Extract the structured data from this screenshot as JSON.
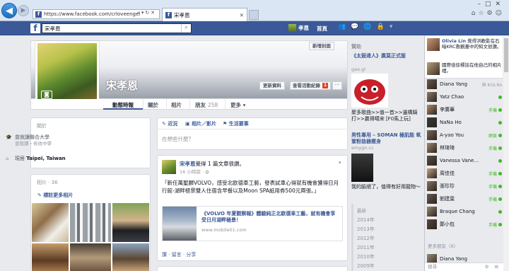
{
  "browser": {
    "address": "https://www.facebook.com/crloveengel",
    "tab_title": "宋孝恩",
    "back_icon": "back-arrow-icon",
    "forward_icon": "forward-arrow-icon"
  },
  "fb_header": {
    "logo": "f",
    "search_value": "宋孝恩",
    "user_name": "孝恩",
    "home_label": "首頁"
  },
  "profile": {
    "name": "宋孝恩",
    "add_cover_label": "新增封面",
    "update_info_label": "更新資料",
    "activity_log_label": "查看活動紀錄",
    "activity_log_count": "1",
    "more_label": "···"
  },
  "tabs": {
    "timeline": "動態時報",
    "about": "關於",
    "photos": "相片",
    "friends": "朋友",
    "friends_count": "258",
    "more": "更多 ▾"
  },
  "about": {
    "heading": "關於",
    "education": "曾就讀聯合大學",
    "education_sub": "曾就讀・修改中學",
    "lives_prefix": "現居",
    "lives_city": "Taipei, Taiwan"
  },
  "photos_card": {
    "heading": "相片 · 36",
    "add_link": "標註更多相片"
  },
  "composer": {
    "status": "近況",
    "photo_video": "相片／影片",
    "life_event": "生活要事",
    "placeholder": "在想些什麼？"
  },
  "post": {
    "author": "宋孝恩",
    "action": "覺得 1 篇文章很讚。",
    "time": "16 小時前 · ",
    "text": "「新任萬聖麟VOLVO，感受北歐德車工藝，發表試車心得就有機會獲得日月行館-湖畔極景雙人住宿含早餐以及Moon SPA紙用券500元兩張。」",
    "link_title": "《VOLVO 年夏觀察報》體驗純正北歐德車工藝，就有機會享受日月湖畔極景！",
    "link_url": "www.mobile01.com",
    "actions": "讚 · 留言 · 分享"
  },
  "ads": {
    "heading": "贊助",
    "ad1_title": "《太鼓達人》廣莫正式版",
    "ad1_domain": "gao.gl",
    "ad2_body": "聚多歌曲>>值一首>>邊構騎打>>贏得噶宋 [F0馬上玩]",
    "ad3_title": "男性專用 – SOMAN 極肌能 氧鞏粉捻器瘦身",
    "ad3_domain": "emygn.cc",
    "ad4_body": "我的臉絕了，值得有好用龍物～"
  },
  "years": {
    "label": "最新",
    "list": [
      "2014年",
      "2013年",
      "2012年",
      "2011年",
      "2010年",
      "2009年"
    ]
  },
  "ticker": [
    {
      "name": "Olivia Lin",
      "text": "覺得洪歡影在石暗KRC救觀畫中的知文很讚。"
    },
    {
      "name": "",
      "text": "國際佳徐標誌在他自己的相片裡。"
    }
  ],
  "chat": [
    {
      "name": "Diana Yang",
      "status": "與 Kris Ko",
      "online": false
    },
    {
      "name": "Yatz Chao",
      "status": "",
      "online": true
    },
    {
      "name": "李廣華",
      "status": "手機",
      "online": true
    },
    {
      "name": "NaNa Ho",
      "status": "",
      "online": true
    },
    {
      "name": "A-yao You",
      "status": "網頁",
      "online": true
    },
    {
      "name": "林琦琦",
      "status": "手機",
      "online": true
    },
    {
      "name": "Vanessa Vane…",
      "status": "",
      "online": true
    },
    {
      "name": "周佳佳",
      "status": "手機",
      "online": true
    },
    {
      "name": "張珍珍",
      "status": "手機",
      "online": true
    },
    {
      "name": "劉建葉",
      "status": "手機",
      "online": true
    },
    {
      "name": "Braque Chang",
      "status": "",
      "online": true
    },
    {
      "name": "鄭小包",
      "status": "手機",
      "online": true
    }
  ],
  "chat_more_label": "更多朋友（6）",
  "chat_more": [
    {
      "name": "Diana Yang",
      "status": "",
      "online": false
    }
  ],
  "chat_search_placeholder": "搜尋",
  "colors": {
    "brand": "#3b5998",
    "online": "#42b72a",
    "badge": "#e0412b"
  }
}
